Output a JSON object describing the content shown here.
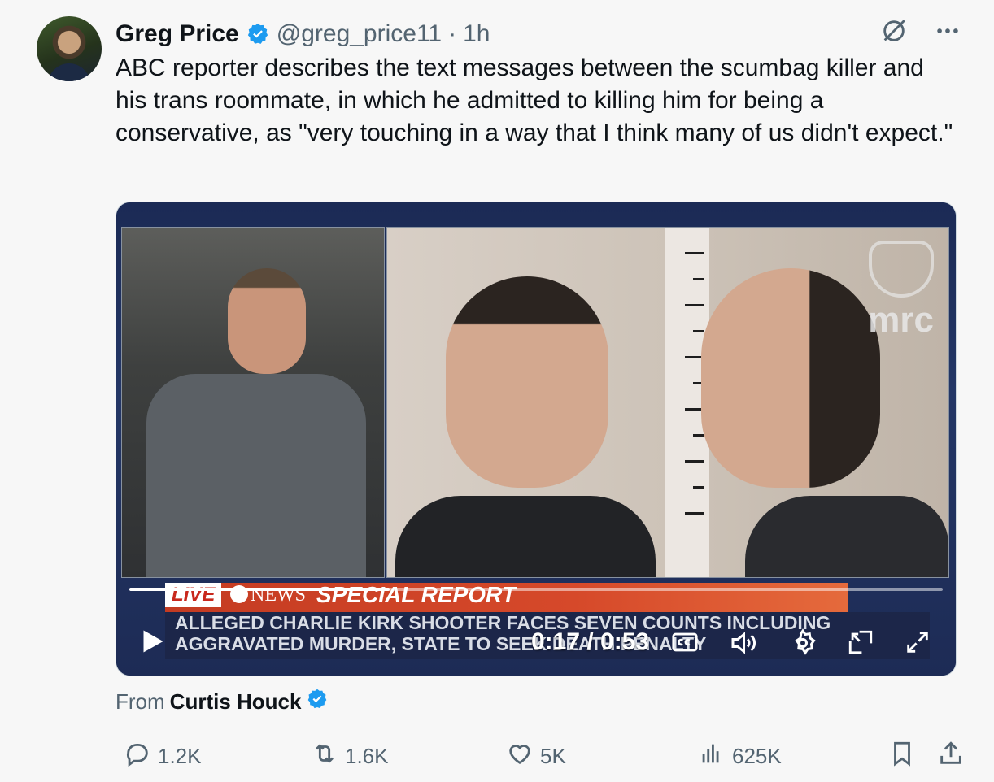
{
  "author": {
    "name": "Greg Price",
    "handle": "@greg_price11",
    "separator": "·",
    "time": "1h",
    "verified_color": "#1d9bf0"
  },
  "tweet": {
    "text": "ABC reporter describes the text messages between the scumbag killer and his trans roommate, in which he admitted to killing him for being a conservative, as \"very touching in a way that I think many of us didn't expect.\""
  },
  "video": {
    "live_label": "LIVE",
    "network_label": "NEWS",
    "banner_label": "SPECIAL REPORT",
    "headline_line1": "ALLEGED CHARLIE KIRK SHOOTER FACES SEVEN COUNTS INCLUDING",
    "headline_line2": "AGGRAVATED MURDER, STATE TO SEEK DEATH PENALTY",
    "watermark": "mrc",
    "timecode": "0:17 / 0:53",
    "progress_fraction": 0.32
  },
  "source": {
    "prefix": "From",
    "name": "Curtis Houck"
  },
  "actions": {
    "replies": "1.2K",
    "reposts": "1.6K",
    "likes": "5K",
    "views": "625K"
  }
}
